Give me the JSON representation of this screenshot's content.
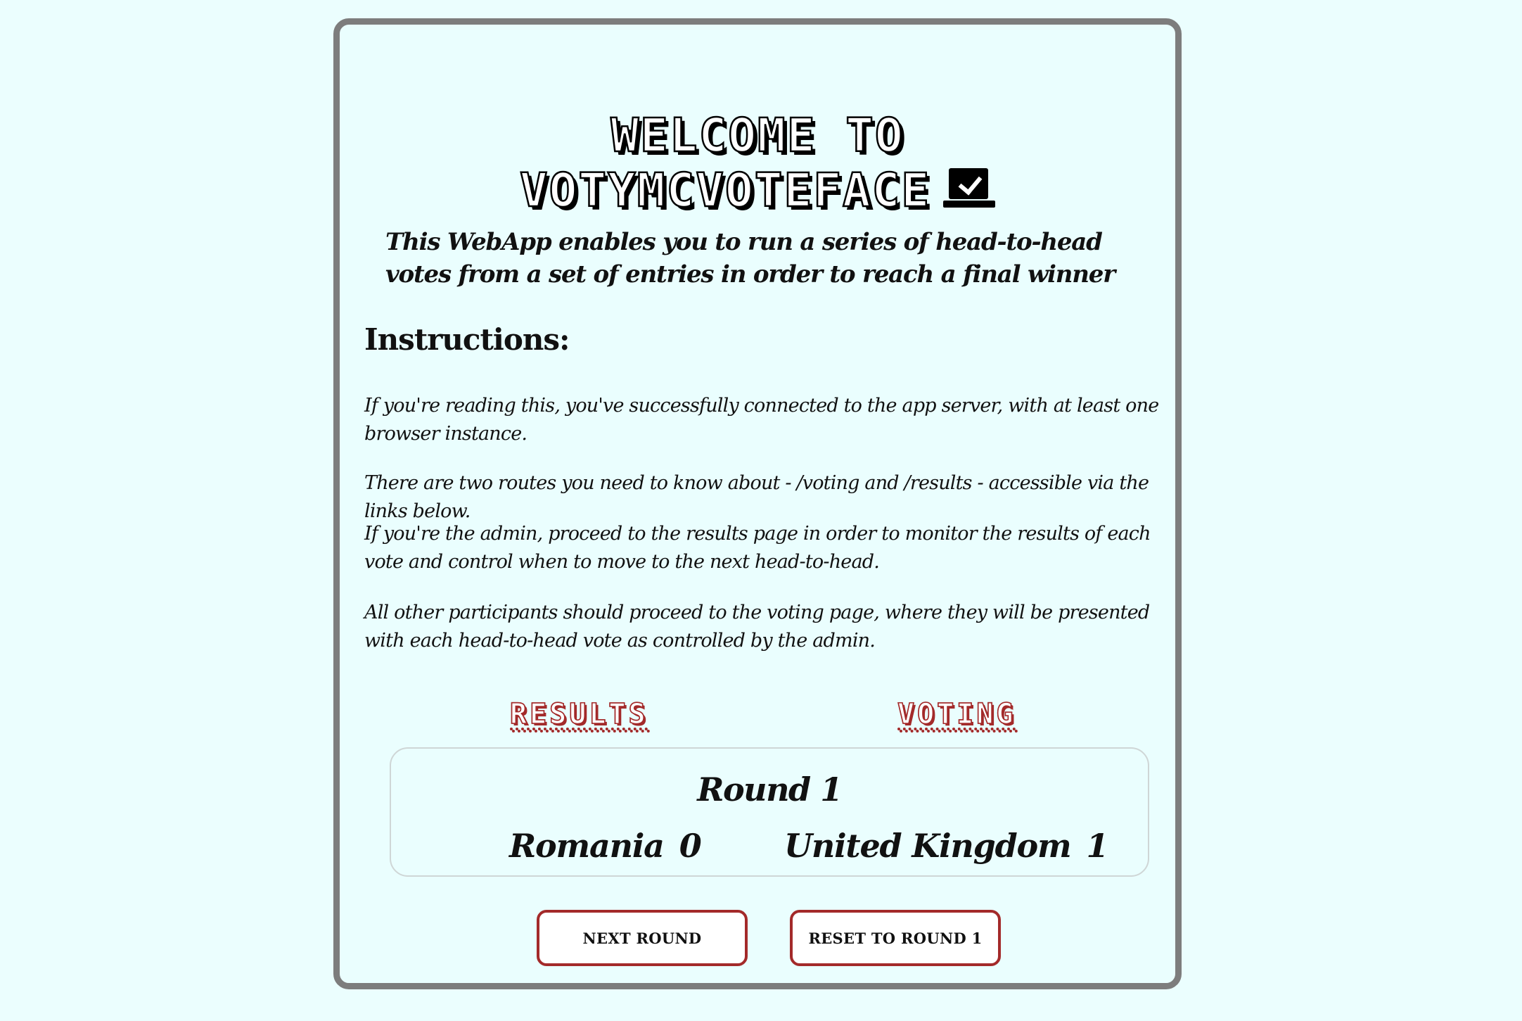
{
  "header": {
    "title_line1": "Welcome to",
    "title_line2": "VotyMcVoteface",
    "title_icon": "ballot-box-with-check-icon"
  },
  "intro": {
    "subtitle": "This WebApp enables you to run a series of head-to-head votes from a set of entries in order to reach a final winner"
  },
  "instructions": {
    "heading": "Instructions:",
    "paragraphs": [
      "If you're reading this, you've successfully connected to the app server, with at least one browser instance.",
      "There are two routes you need to know about - /voting and /results - accessible via the links below.",
      "If you're the admin, proceed to the results page in order to monitor the results of each vote and control when to move to the next head-to-head.",
      "All other participants should proceed to the voting page, where they will be presented with each head-to-head vote as controlled by the admin."
    ]
  },
  "links": {
    "results": "Results",
    "voting": "Voting"
  },
  "round": {
    "title": "Round 1",
    "entries": [
      {
        "name": "Romania",
        "votes": "0"
      },
      {
        "name": "United Kingdom",
        "votes": "1"
      }
    ]
  },
  "buttons": {
    "next_round": "Next Round",
    "reset": "Reset to Round 1"
  },
  "colors": {
    "background": "#ebfefe",
    "card_border": "#7d7d7d",
    "accent": "#a32a2a"
  }
}
